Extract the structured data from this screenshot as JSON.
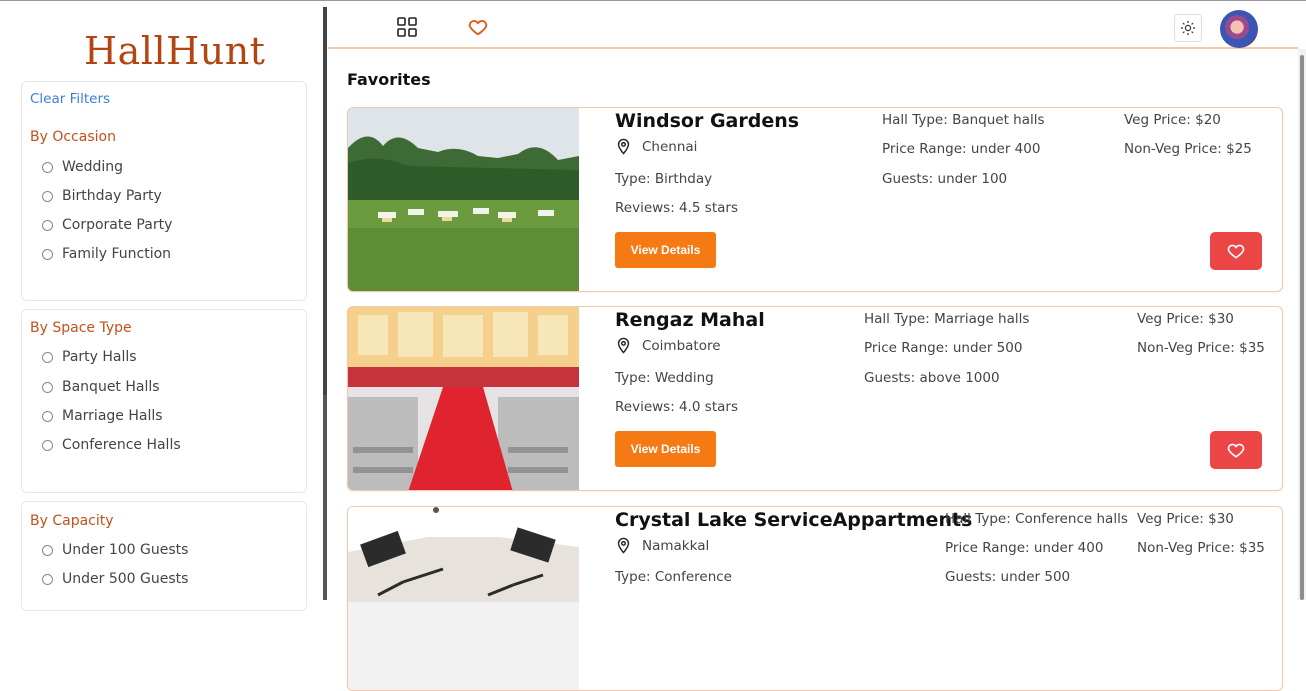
{
  "sidebar": {
    "logo": "HallHunt",
    "clear_filters": "Clear Filters",
    "occasion": {
      "title": "By Occasion",
      "options": [
        "Wedding",
        "Birthday Party",
        "Corporate Party",
        "Family Function"
      ]
    },
    "space_type": {
      "title": "By Space Type",
      "options": [
        "Party Halls",
        "Banquet Halls",
        "Marriage Halls",
        "Conference Halls"
      ]
    },
    "capacity": {
      "title": "By Capacity",
      "options": [
        "Under 100 Guests",
        "Under 500 Guests"
      ]
    }
  },
  "header": {
    "grid_icon": "grid-icon",
    "heart_icon": "heart-icon",
    "theme_icon": "sun-icon"
  },
  "main": {
    "title": "Favorites",
    "cards": [
      {
        "name": "Windsor Gardens",
        "location": "Chennai",
        "type": "Type: Birthday",
        "reviews": "Reviews: 4.5 stars",
        "hall_type": "Hall Type: Banquet halls",
        "price_range": "Price Range: under 400",
        "guests": "Guests: under 100",
        "veg_price": "Veg Price: $20",
        "nonveg_price": "Non-Veg Price: $25",
        "view_label": "View Details"
      },
      {
        "name": "Rengaz Mahal",
        "location": "Coimbatore",
        "type": "Type: Wedding",
        "reviews": "Reviews: 4.0 stars",
        "hall_type": "Hall Type: Marriage halls",
        "price_range": "Price Range: under 500",
        "guests": "Guests: above 1000",
        "veg_price": "Veg Price: $30",
        "nonveg_price": "Non-Veg Price: $35",
        "view_label": "View Details"
      },
      {
        "name": "Crystal Lake ServiceAppartments",
        "location": "Namakkal",
        "type": "Type: Conference",
        "hall_type": "Hall Type: Conference halls",
        "price_range": "Price Range: under 400",
        "guests": "Guests: under 500",
        "veg_price": "Veg Price: $30",
        "nonveg_price": "Non-Veg Price: $35"
      }
    ]
  },
  "colors": {
    "accent": "#f57a14",
    "brand": "#b34512",
    "heart": "#ec4545",
    "link": "#3b7fd6"
  }
}
